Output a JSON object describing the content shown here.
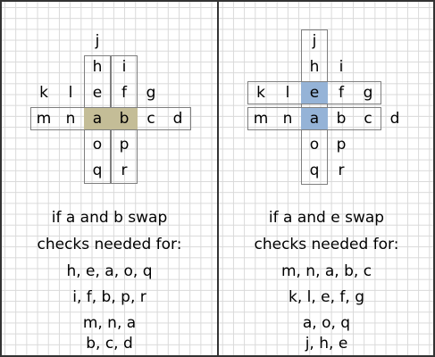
{
  "colors": {
    "border": "#333333",
    "grid": "#d9d9d9",
    "box_outline": "#7f7f7f",
    "highlight_olive": "#c4bd97",
    "highlight_blue": "#95b3d7"
  },
  "panels": [
    {
      "id": "left",
      "highlight": [
        "a",
        "b"
      ],
      "highlight_color": "#c4bd97",
      "letters": {
        "j": "j",
        "h": "h",
        "i": "i",
        "k": "k",
        "l": "l",
        "e": "e",
        "f": "f",
        "g": "g",
        "m": "m",
        "n": "n",
        "a": "a",
        "b": "b",
        "c": "c",
        "d": "d",
        "o": "o",
        "p": "p",
        "q": "q",
        "r": "r"
      },
      "swap_text": "if a and b swap",
      "checks_heading": "checks needed for:",
      "checks": [
        "h, e, a, o, q",
        "i, f, b, p, r",
        "m, n, a",
        "b, c, d"
      ]
    },
    {
      "id": "right",
      "highlight": [
        "e",
        "a"
      ],
      "highlight_color": "#95b3d7",
      "letters": {
        "j": "j",
        "h": "h",
        "i": "i",
        "k": "k",
        "l": "l",
        "e": "e",
        "f": "f",
        "g": "g",
        "m": "m",
        "n": "n",
        "a": "a",
        "b": "b",
        "c": "c",
        "d": "d",
        "o": "o",
        "p": "p",
        "q": "q",
        "r": "r"
      },
      "swap_text": "if a and e swap",
      "checks_heading": "checks needed for:",
      "checks": [
        "m, n, a, b, c",
        "k, l, e, f, g",
        "a, o, q",
        "j, h, e"
      ]
    }
  ]
}
